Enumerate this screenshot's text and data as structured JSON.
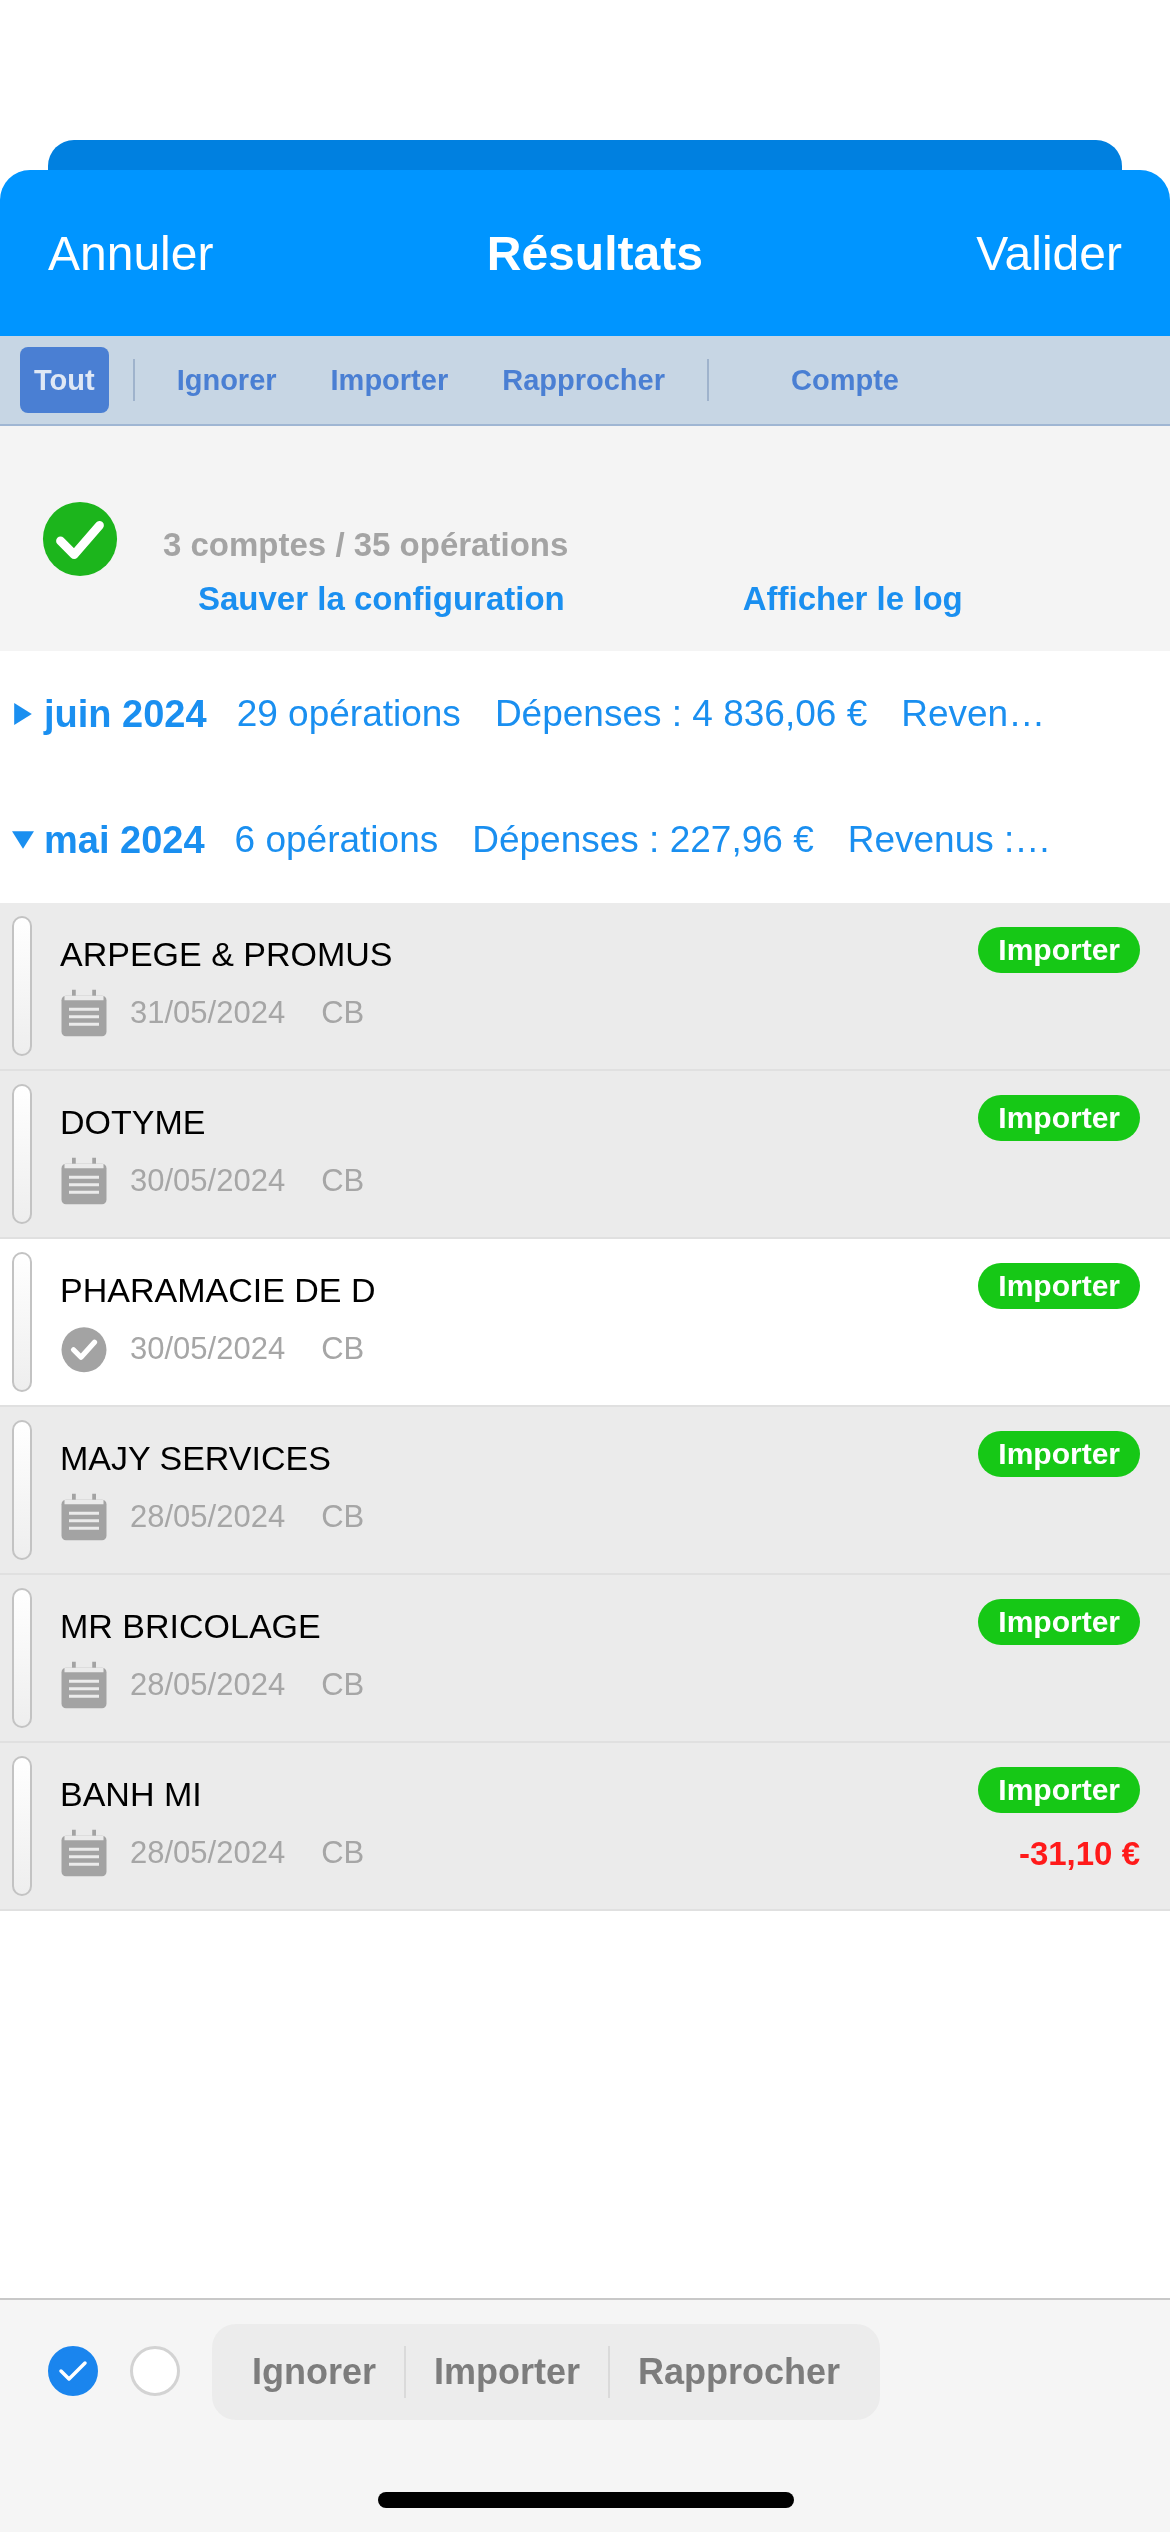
{
  "header": {
    "cancel": "Annuler",
    "title": "Résultats",
    "confirm": "Valider"
  },
  "filters": [
    {
      "label": "Tout",
      "selected": true,
      "divider_after": true
    },
    {
      "label": "Ignorer",
      "selected": false,
      "divider_after": false
    },
    {
      "label": "Importer",
      "selected": false,
      "divider_after": false
    },
    {
      "label": "Rapprocher",
      "selected": false,
      "divider_after": true
    },
    {
      "label": "Compte",
      "selected": false,
      "divider_after": false
    }
  ],
  "account": {
    "success": true,
    "summary": "3 comptes / 35 opérations",
    "links": [
      "Sauver la configuration",
      "Afficher le log"
    ]
  },
  "months": [
    {
      "name": "juin 2024",
      "expanded": false,
      "count": "29 opérations",
      "expenses": "Dépenses : 4 836,06 €",
      "income": "Reven…"
    },
    {
      "name": "mai 2024",
      "expanded": true,
      "count": "6 opérations",
      "expenses": "Dépenses : 227,96 €",
      "income": "Revenus :…"
    }
  ],
  "operations": [
    {
      "label": "ARPEGE & PROMUS",
      "kind": "calendar",
      "date": "31/05/2024",
      "type": "CB",
      "action": "Importer",
      "selected": false
    },
    {
      "label": "DOTYME",
      "kind": "calendar",
      "date": "30/05/2024",
      "type": "CB",
      "action": "Importer",
      "selected": false
    },
    {
      "label": "PHARAMACIE DE D",
      "kind": "check",
      "date": "30/05/2024",
      "type": "CB",
      "action": "Importer",
      "selected": true
    },
    {
      "label": "MAJY SERVICES",
      "kind": "calendar",
      "date": "28/05/2024",
      "type": "CB",
      "action": "Importer",
      "selected": false
    },
    {
      "label": "MR BRICOLAGE",
      "kind": "calendar",
      "date": "28/05/2024",
      "type": "CB",
      "action": "Importer",
      "selected": false
    },
    {
      "label": "BANH MI",
      "kind": "calendar",
      "date": "28/05/2024",
      "type": "CB",
      "action": "Importer",
      "amount": "-31,10 €",
      "selected": false
    }
  ],
  "toolbar": {
    "select_all": {
      "checked": true
    },
    "select_none": {
      "checked": false
    },
    "actions": [
      "Ignorer",
      "Importer",
      "Rapprocher"
    ]
  }
}
